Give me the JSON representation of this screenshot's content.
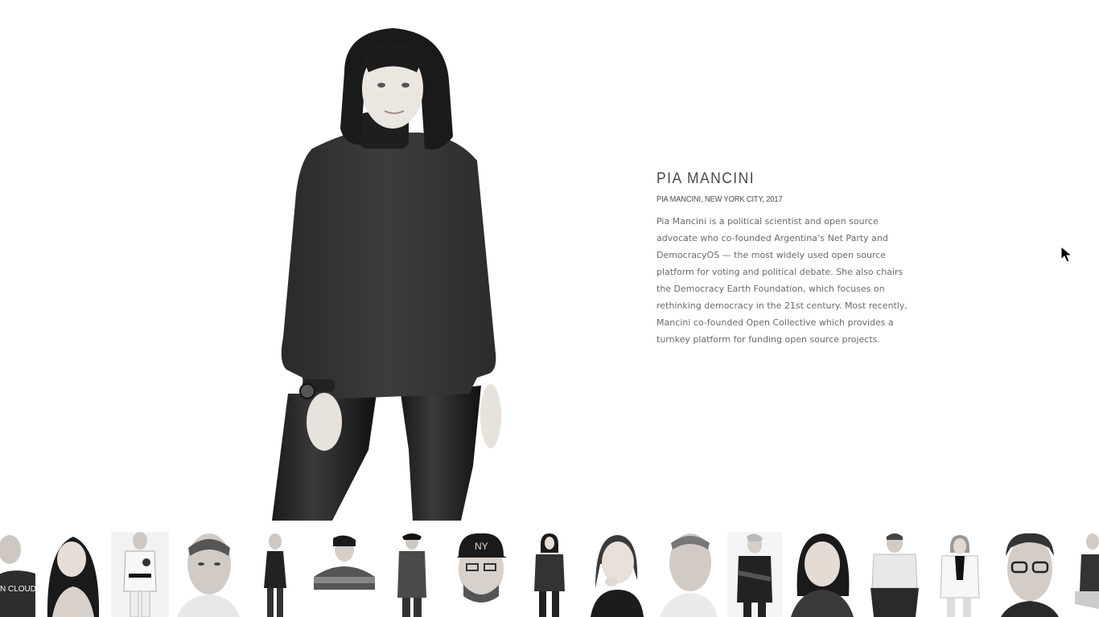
{
  "profile": {
    "name": "PIA MANCINI",
    "caption": "PIA MANCINI, NEW YORK CITY, 2017",
    "bio": "Pia Mancini is a political scientist and open source advocate who co-founded Argentina’s Net Party and DemocracyOS — the most widely used open source platform for voting and political debate. She also chairs the Democracy Earth Foundation, which focuses on rethinking democracy in the 21st century. Most recently, Mancini co-founded Open Collective which provides a turnkey platform for funding open source projects."
  },
  "thumbnails": [
    {
      "label": "N CLOUD"
    },
    {},
    {},
    {},
    {},
    {},
    {},
    {},
    {},
    {},
    {},
    {},
    {},
    {},
    {},
    {},
    {}
  ]
}
